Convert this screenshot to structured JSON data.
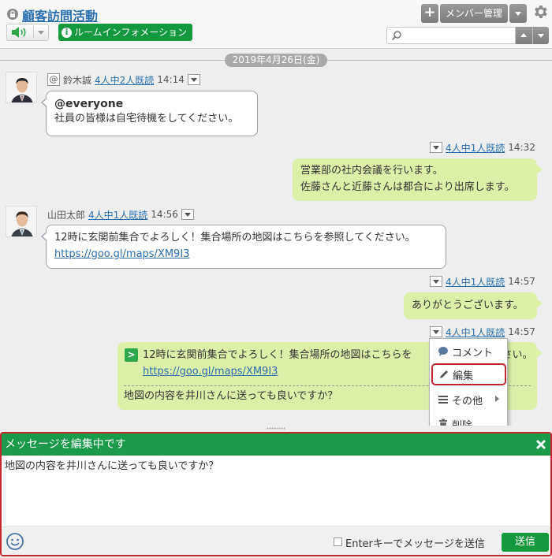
{
  "header": {
    "title": "顧客訪問活動",
    "room_info_label": "ルームインフォメーション",
    "add_button_label": "+",
    "member_button_label": "メンバー管理",
    "search_placeholder": ""
  },
  "timeline": {
    "date": "2019年4月26日(金)",
    "messages": [
      {
        "sender": "鈴木誠",
        "read": "4人中2人既読",
        "time": "14:14",
        "mention": "@everyone",
        "text": "社員の皆様は自宅待機をしてください。"
      },
      {
        "read": "4人中1人既読",
        "time": "14:32",
        "lines": [
          "営業部の社内会議を行います。",
          "佐藤さんと近藤さんは都合により出席します。"
        ]
      },
      {
        "sender": "山田太郎",
        "read": "4人中1人既読",
        "time": "14:56",
        "text": "12時に玄関前集合でよろしく！集合場所の地図はこちらを参照してください。",
        "link": "https://goo.gl/maps/XM9I3"
      },
      {
        "read": "4人中1人既読",
        "time": "14:57",
        "text": "ありがとうございます。"
      },
      {
        "read": "4人中1人既読",
        "time": "14:57",
        "quote_visible": "12時に玄関前集合でよろしく！集合場所の地図はこちらを",
        "quote_tail": "ください。",
        "quote_link": "https://goo.gl/maps/XM9I3",
        "text": "地図の内容を井川さんに送っても良いですか？"
      }
    ]
  },
  "context_menu": {
    "items": [
      {
        "label": "コメント",
        "icon": "comment-icon"
      },
      {
        "label": "編集",
        "icon": "pencil-icon"
      },
      {
        "label": "その他",
        "icon": "list-icon"
      },
      {
        "label": "削除",
        "icon": "trash-icon"
      }
    ]
  },
  "editor": {
    "banner": "メッセージを編集中です",
    "text": "地図の内容を井川さんに送っても良いですか？",
    "enter_label": "Enterキーでメッセージを送信",
    "send_label": "送信"
  },
  "colors": {
    "accent_green": "#15993f",
    "outgoing_bubble": "#dcf0a8",
    "highlight_red": "#c0282e",
    "link_blue": "#2a6fb0"
  }
}
